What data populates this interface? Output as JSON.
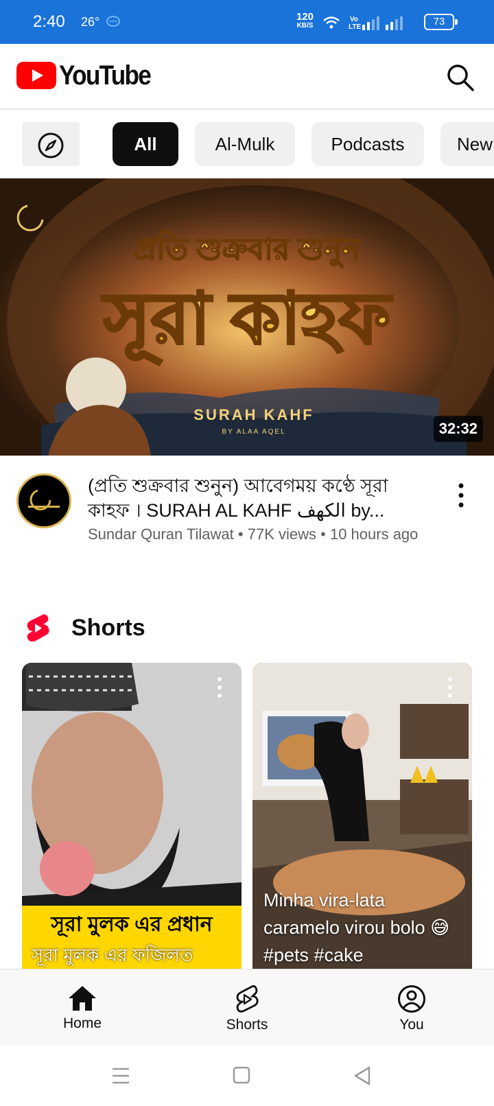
{
  "status_bar": {
    "time": "2:40",
    "temperature": "26°",
    "net_speed_value": "120",
    "net_speed_unit": "KB/S",
    "volte": "Vo\nLTE",
    "battery": "73"
  },
  "header": {
    "brand": "YouTube",
    "brand_color": "#ff0000"
  },
  "chips": [
    {
      "label": "All",
      "active": true
    },
    {
      "label": "Al-Mulk",
      "active": false
    },
    {
      "label": "Podcasts",
      "active": false
    },
    {
      "label": "New",
      "active": false
    }
  ],
  "video": {
    "duration": "32:32",
    "title": "(প্রতি শুক্রবার শুনুন) আবেগময় কণ্ঠে সূরা কাহফ । SURAH AL KAHF الكهف by...",
    "channel": "Sundar Quran Tilawat",
    "views": "77K views",
    "age": "10 hours ago",
    "thumb_line1": "প্রতি শুক্রবার শুনুন",
    "thumb_line2": "সূরা কাহফ",
    "thumb_line3": "SURAH KAHF",
    "thumb_line4": "BY ALAA AQEL"
  },
  "shorts": {
    "section_title": "Shorts",
    "items": [
      {
        "band_text": "সূরা মুলক এর প্রধান",
        "band_sub": "সূরা মুলক এর ফজিলত"
      },
      {
        "caption": "Minha vira-lata caramelo virou bolo 😅 #pets #cake"
      }
    ]
  },
  "bottom_nav": [
    {
      "label": "Home",
      "icon": "home-icon"
    },
    {
      "label": "Shorts",
      "icon": "shorts-icon"
    },
    {
      "label": "You",
      "icon": "account-icon"
    }
  ]
}
